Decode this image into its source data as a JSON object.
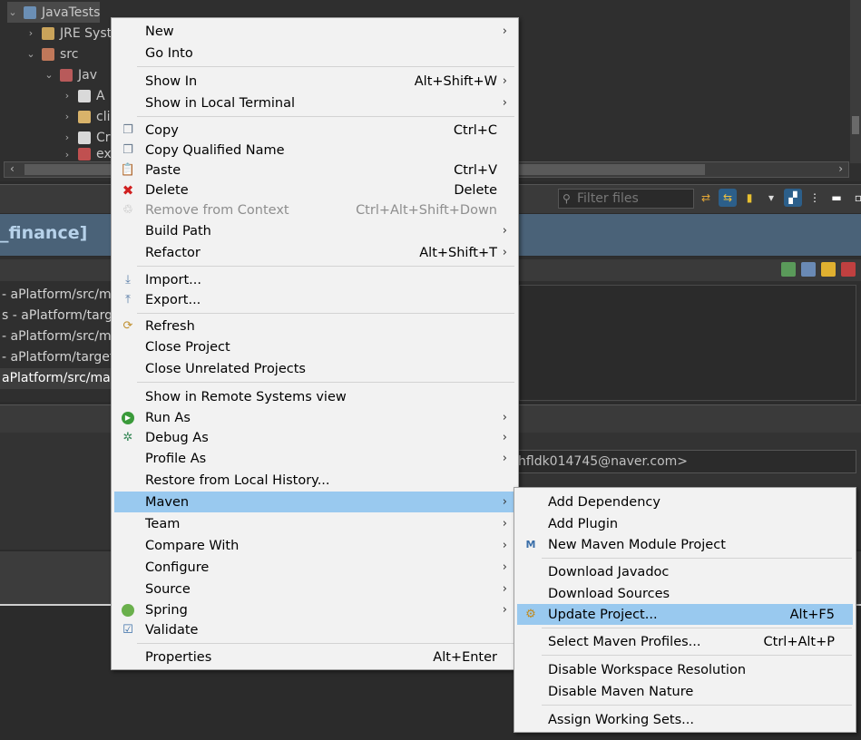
{
  "tree": {
    "project": "JavaTests",
    "jre": "JRE Syst",
    "src": "src",
    "package": "Jav",
    "files": [
      "A",
      "cli",
      "Cr",
      "ex"
    ]
  },
  "filter": {
    "placeholder": "Filter files"
  },
  "title_bar": {
    "text": "_finance]"
  },
  "bg_rows": [
    "- aPlatform/src/ma",
    "s - aPlatform/targe",
    "- aPlatform/src/m",
    "- aPlatform/target/",
    "aPlatform/src/ma"
  ],
  "email": "hfldk014745@naver.com>",
  "main_menu": [
    {
      "label": "New",
      "shortcut": "",
      "submenu": true
    },
    {
      "label": "Go Into",
      "shortcut": "",
      "submenu": false
    },
    {
      "label": "Show In",
      "shortcut": "Alt+Shift+W",
      "submenu": true
    },
    {
      "label": "Show in Local Terminal",
      "shortcut": "",
      "submenu": true
    },
    {
      "label": "Copy",
      "shortcut": "Ctrl+C",
      "submenu": false
    },
    {
      "label": "Copy Qualified Name",
      "shortcut": "",
      "submenu": false
    },
    {
      "label": "Paste",
      "shortcut": "Ctrl+V",
      "submenu": false
    },
    {
      "label": "Delete",
      "shortcut": "Delete",
      "submenu": false
    },
    {
      "label": "Remove from Context",
      "shortcut": "Ctrl+Alt+Shift+Down",
      "submenu": false
    },
    {
      "label": "Build Path",
      "shortcut": "",
      "submenu": true
    },
    {
      "label": "Refactor",
      "shortcut": "Alt+Shift+T",
      "submenu": true
    },
    {
      "label": "Import...",
      "shortcut": "",
      "submenu": false
    },
    {
      "label": "Export...",
      "shortcut": "",
      "submenu": false
    },
    {
      "label": "Refresh",
      "shortcut": "",
      "submenu": false
    },
    {
      "label": "Close Project",
      "shortcut": "",
      "submenu": false
    },
    {
      "label": "Close Unrelated Projects",
      "shortcut": "",
      "submenu": false
    },
    {
      "label": "Show in Remote Systems view",
      "shortcut": "",
      "submenu": false
    },
    {
      "label": "Run As",
      "shortcut": "",
      "submenu": true
    },
    {
      "label": "Debug As",
      "shortcut": "",
      "submenu": true
    },
    {
      "label": "Profile As",
      "shortcut": "",
      "submenu": true
    },
    {
      "label": "Restore from Local History...",
      "shortcut": "",
      "submenu": false
    },
    {
      "label": "Maven",
      "shortcut": "",
      "submenu": true
    },
    {
      "label": "Team",
      "shortcut": "",
      "submenu": true
    },
    {
      "label": "Compare With",
      "shortcut": "",
      "submenu": true
    },
    {
      "label": "Configure",
      "shortcut": "",
      "submenu": true
    },
    {
      "label": "Source",
      "shortcut": "",
      "submenu": true
    },
    {
      "label": "Spring",
      "shortcut": "",
      "submenu": true
    },
    {
      "label": "Validate",
      "shortcut": "",
      "submenu": false
    },
    {
      "label": "Properties",
      "shortcut": "Alt+Enter",
      "submenu": false
    }
  ],
  "maven_menu": [
    {
      "label": "Add Dependency",
      "shortcut": ""
    },
    {
      "label": "Add Plugin",
      "shortcut": ""
    },
    {
      "label": "New Maven Module Project",
      "shortcut": ""
    },
    {
      "label": "Download Javadoc",
      "shortcut": ""
    },
    {
      "label": "Download Sources",
      "shortcut": ""
    },
    {
      "label": "Update Project...",
      "shortcut": "Alt+F5"
    },
    {
      "label": "Select Maven Profiles...",
      "shortcut": "Ctrl+Alt+P"
    },
    {
      "label": "Disable Workspace Resolution",
      "shortcut": ""
    },
    {
      "label": "Disable Maven Nature",
      "shortcut": ""
    },
    {
      "label": "Assign Working Sets...",
      "shortcut": ""
    }
  ],
  "colors": {
    "menu_bg": "#f2f2f2",
    "highlight": "#99c9ef",
    "title_bar": "#4a6278",
    "title_text": "#b7d2ea"
  }
}
